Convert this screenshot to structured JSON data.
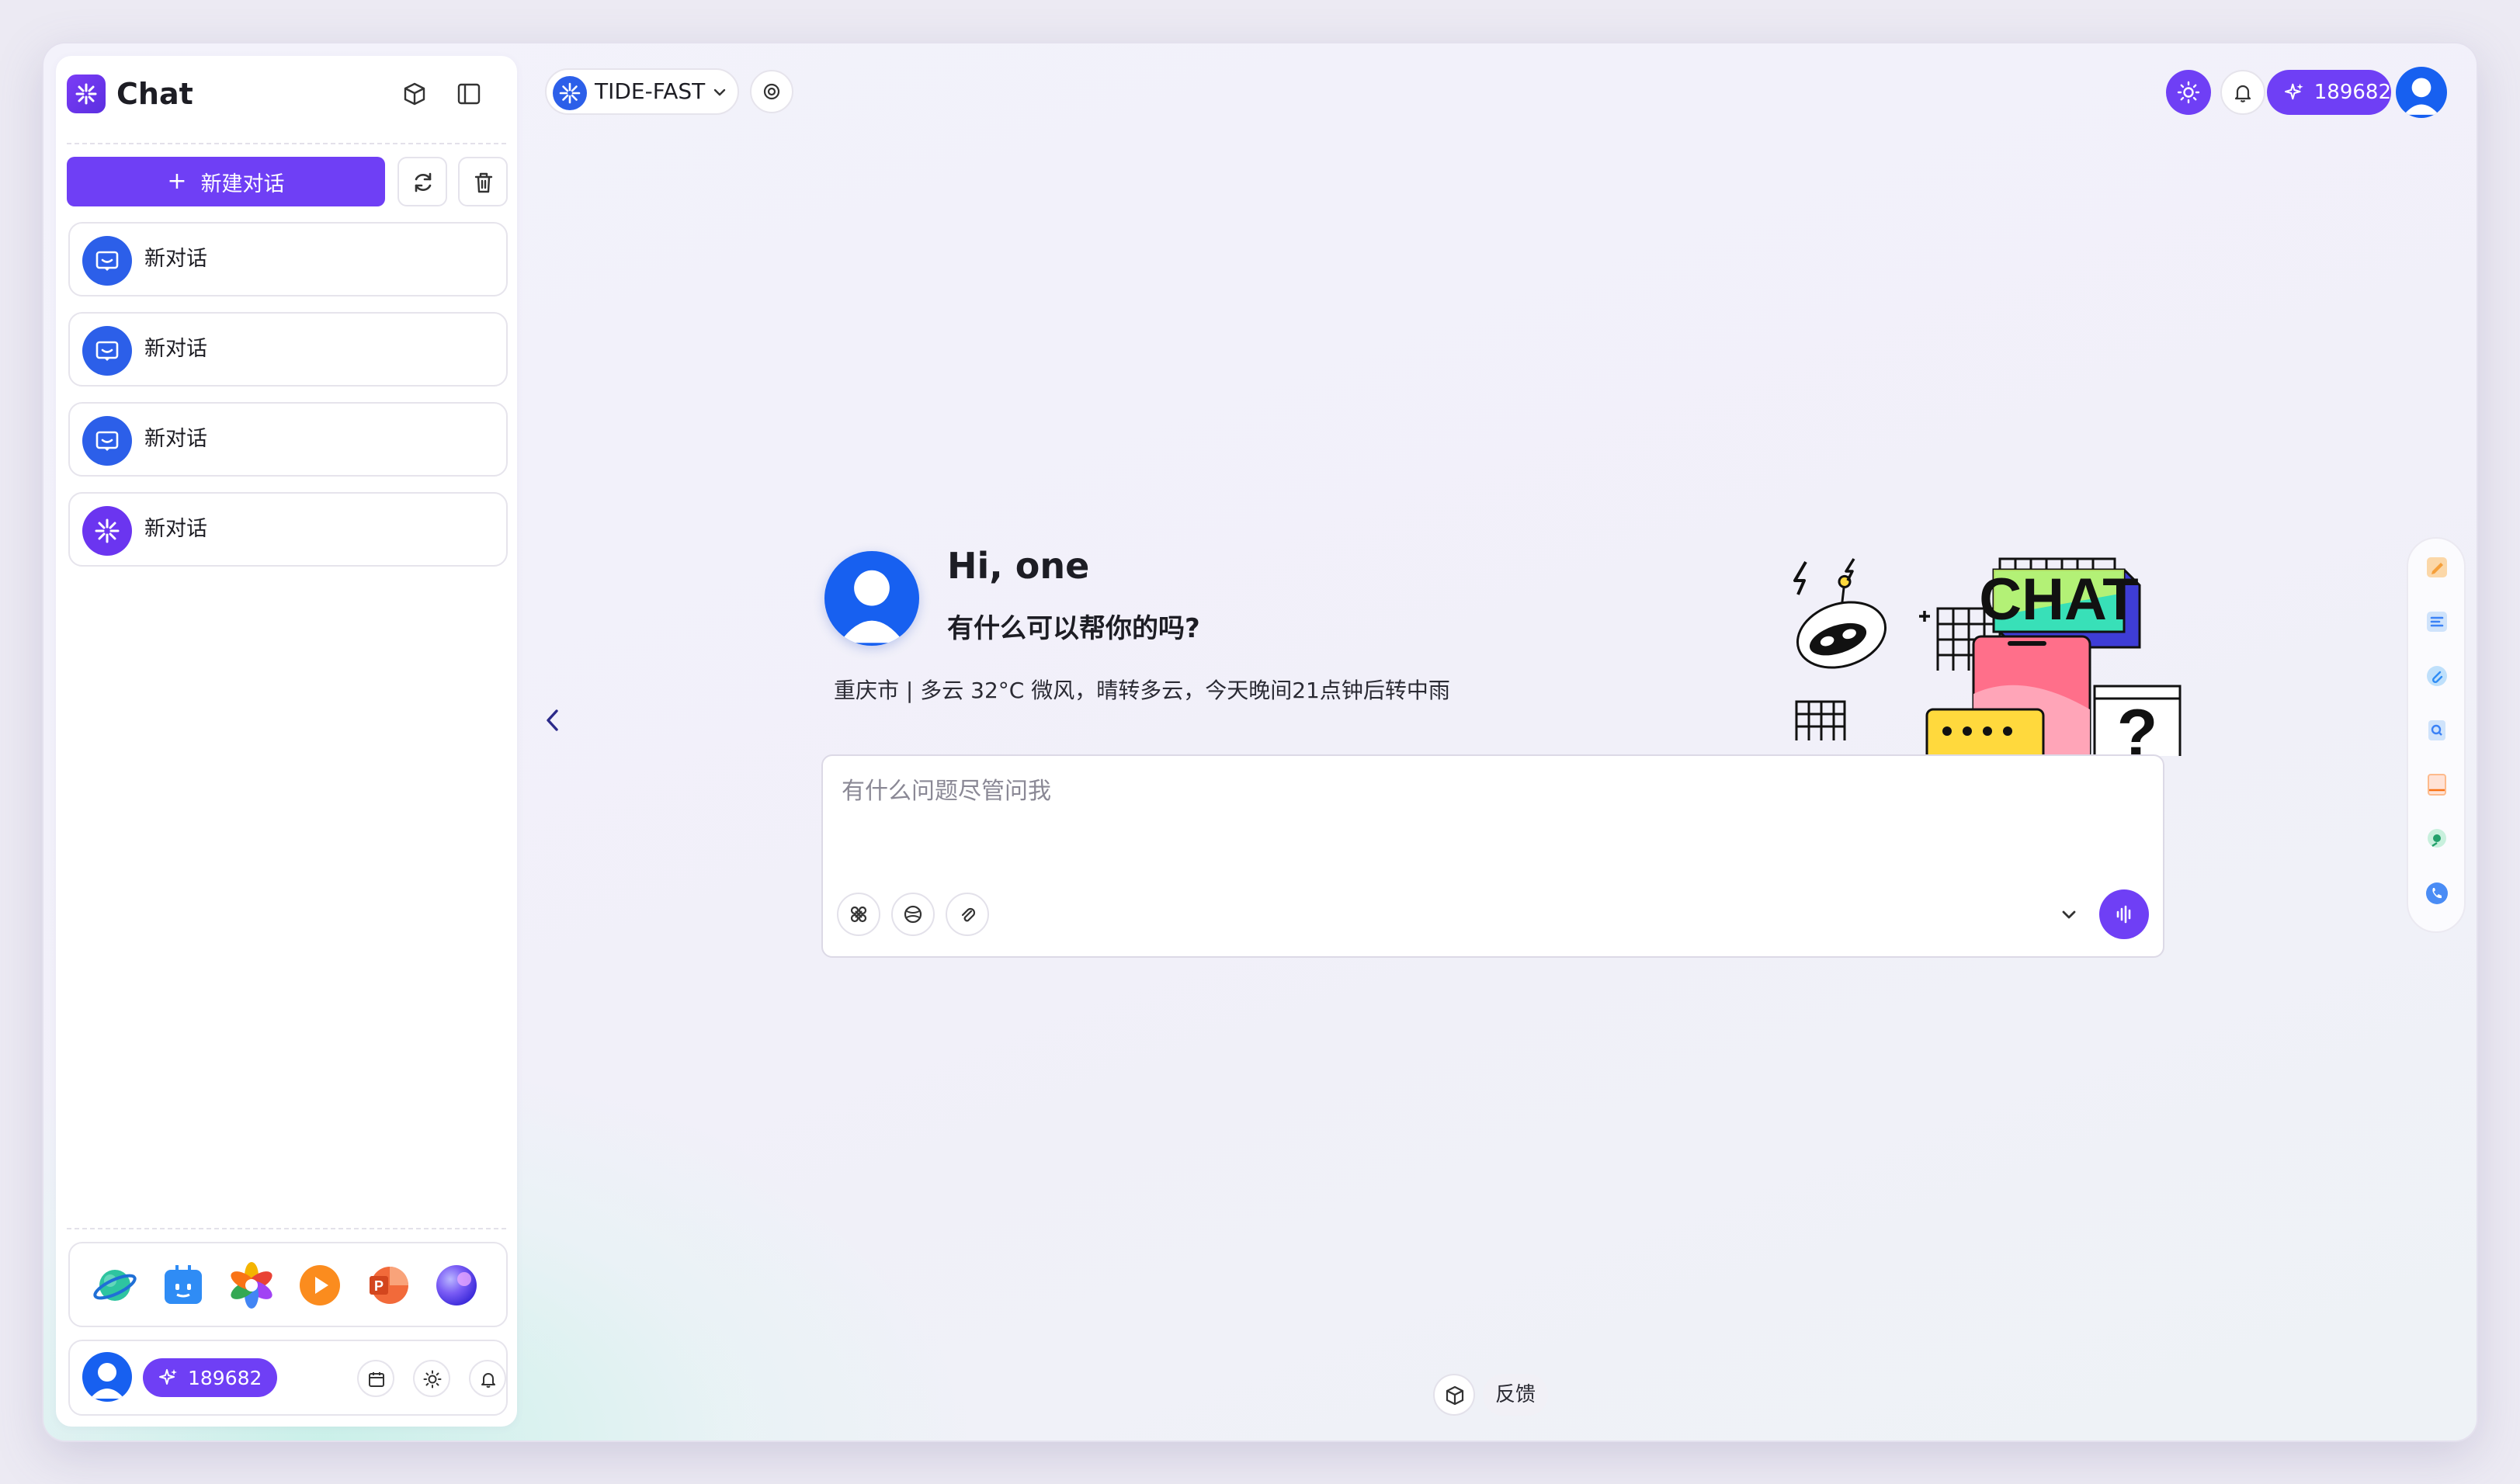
{
  "app": {
    "title": "Chat"
  },
  "sidebar": {
    "new_chat_label": "新建对话",
    "conversations": [
      {
        "label": "新对话",
        "icon": "chat-bubble-icon"
      },
      {
        "label": "新对话",
        "icon": "chat-bubble-icon"
      },
      {
        "label": "新对话",
        "icon": "chat-bubble-icon"
      },
      {
        "label": "新对话",
        "icon": "aperture-logo-icon"
      }
    ],
    "apps": [
      "planet-app-icon",
      "robot-app-icon",
      "photos-app-icon",
      "video-app-icon",
      "powerpoint-app-icon",
      "orb-app-icon"
    ],
    "user_credits": "189682"
  },
  "topbar": {
    "model_name": "TIDE-FAST",
    "credits": "189682"
  },
  "welcome": {
    "greeting": "Hi, one",
    "subtitle": "有什么可以帮你的吗?",
    "weather": "重庆市 | 多云 32°C 微风，晴转多云，今天晚间21点钟后转中雨"
  },
  "composer": {
    "placeholder": "有什么问题尽管问我"
  },
  "illustration": {
    "text": "CHAT"
  },
  "footer": {
    "feedback_label": "反馈"
  },
  "colors": {
    "accent": "#6f3ff5",
    "brand_blue": "#2c5fe9"
  }
}
